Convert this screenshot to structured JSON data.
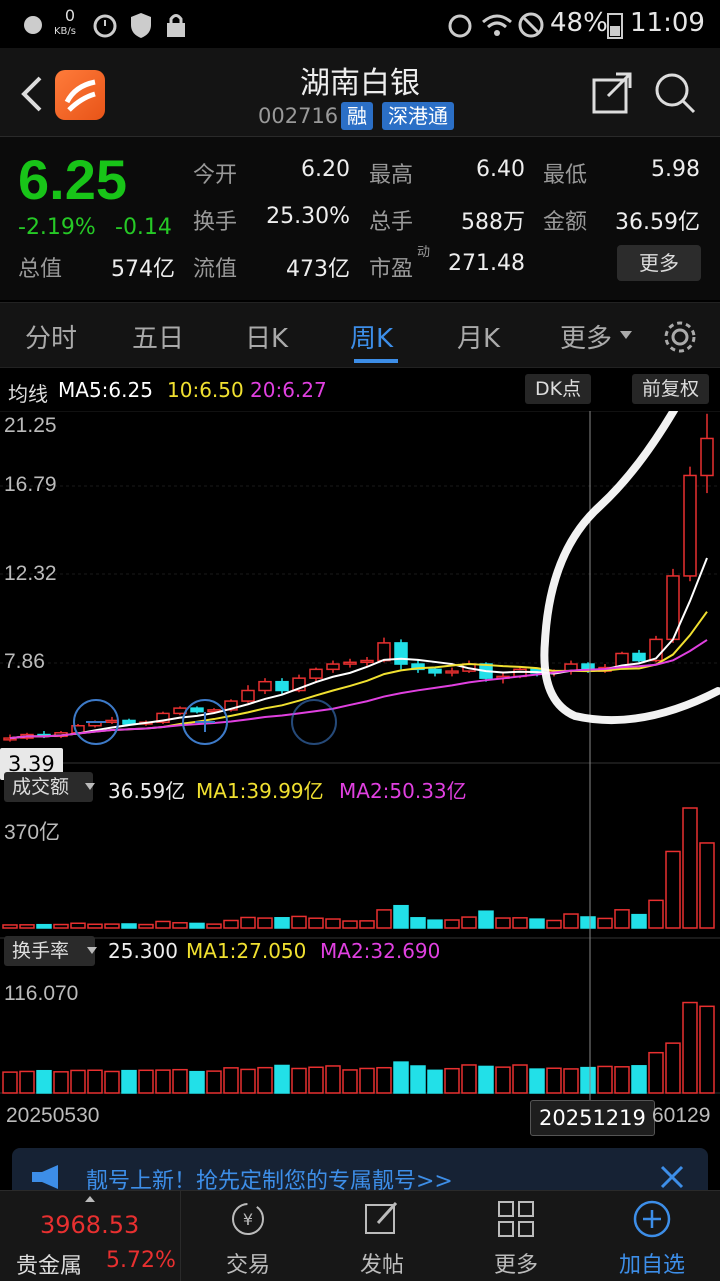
{
  "status": {
    "speed": "0",
    "speed_unit": "KB/s",
    "battery": "48%",
    "time": "11:09"
  },
  "header": {
    "name": "湖南白银",
    "code": "002716",
    "tags": [
      "融",
      "深港通"
    ]
  },
  "quote": {
    "price": "6.25",
    "change_pct": "-2.19%",
    "change": "-0.14",
    "fields": [
      {
        "label": "今开",
        "value": "6.20",
        "color": "green"
      },
      {
        "label": "最高",
        "value": "6.40",
        "color": "red"
      },
      {
        "label": "最低",
        "value": "5.98",
        "color": "green"
      },
      {
        "label": "换手",
        "value": "25.30%",
        "color": "white"
      },
      {
        "label": "总手",
        "value": "588万",
        "color": "white"
      },
      {
        "label": "金额",
        "value": "36.59亿",
        "color": "white"
      },
      {
        "label": "总值",
        "value": "574亿",
        "color": "white"
      },
      {
        "label": "流值",
        "value": "473亿",
        "color": "white"
      },
      {
        "label": "市盈",
        "sup": "动",
        "value": "271.48",
        "color": "white"
      }
    ],
    "more_label": "更多"
  },
  "tabs": [
    "分时",
    "五日",
    "日K",
    "周K",
    "月K",
    "更多"
  ],
  "active_tab": "周K",
  "kline": {
    "ma_title": "均线",
    "ma5": "MA5:6.25",
    "ma10": "10:6.50",
    "ma20": "20:6.27",
    "dk_label": "DK点",
    "fq_label": "前复权",
    "y_labels": [
      "21.25",
      "16.79",
      "12.32",
      "7.86"
    ],
    "low_marker": "3.39",
    "colors": {
      "up": "#e83030",
      "down": "#22e0e8",
      "ma5": "#ffffff",
      "ma10": "#f0e030",
      "ma20": "#e040e0"
    }
  },
  "volume": {
    "selector": "成交额",
    "value": "36.59亿",
    "ma1": "MA1:39.99亿",
    "ma2": "MA2:50.33亿",
    "max_label": "370亿"
  },
  "turnover": {
    "selector": "换手率",
    "value": "25.300",
    "ma1": "MA1:27.050",
    "ma2": "MA2:32.690",
    "max_label": "116.070"
  },
  "dates": {
    "start": "20250530",
    "cursor": "20251219",
    "end": "60129"
  },
  "ad": {
    "text": "靓号上新！抢先定制您的专属靓号>>"
  },
  "bottom": {
    "index_value": "3968.53",
    "index_name": "贵金属",
    "index_pct": "5.72%",
    "nav": [
      "交易",
      "发帖",
      "更多",
      "加自选"
    ]
  },
  "chart_data": {
    "type": "candlestick",
    "y_axis_labels": [
      21.25,
      16.79,
      12.32,
      7.86
    ],
    "x_labels": [
      "20250530",
      "20251219",
      "60129"
    ],
    "candles": [
      {
        "o": 3.5,
        "c": 3.6,
        "h": 3.8,
        "l": 3.4
      },
      {
        "o": 3.6,
        "c": 3.8,
        "h": 3.9,
        "l": 3.5
      },
      {
        "o": 3.8,
        "c": 3.7,
        "h": 4.0,
        "l": 3.6
      },
      {
        "o": 3.7,
        "c": 3.9,
        "h": 4.0,
        "l": 3.6
      },
      {
        "o": 3.9,
        "c": 4.3,
        "h": 4.4,
        "l": 3.8
      },
      {
        "o": 4.3,
        "c": 4.5,
        "h": 4.6,
        "l": 4.2
      },
      {
        "o": 4.5,
        "c": 4.6,
        "h": 4.8,
        "l": 4.4
      },
      {
        "o": 4.6,
        "c": 4.4,
        "h": 4.7,
        "l": 4.3
      },
      {
        "o": 4.4,
        "c": 4.5,
        "h": 4.6,
        "l": 4.3
      },
      {
        "o": 4.5,
        "c": 5.0,
        "h": 5.1,
        "l": 4.4
      },
      {
        "o": 5.0,
        "c": 5.3,
        "h": 5.4,
        "l": 4.9
      },
      {
        "o": 5.3,
        "c": 5.1,
        "h": 5.4,
        "l": 5.0
      },
      {
        "o": 5.1,
        "c": 5.2,
        "h": 5.3,
        "l": 5.0
      },
      {
        "o": 5.2,
        "c": 5.7,
        "h": 5.8,
        "l": 5.1
      },
      {
        "o": 5.7,
        "c": 6.3,
        "h": 6.6,
        "l": 5.6
      },
      {
        "o": 6.3,
        "c": 6.8,
        "h": 7.0,
        "l": 6.1
      },
      {
        "o": 6.8,
        "c": 6.3,
        "h": 7.0,
        "l": 6.1
      },
      {
        "o": 6.3,
        "c": 7.0,
        "h": 7.2,
        "l": 6.2
      },
      {
        "o": 7.0,
        "c": 7.5,
        "h": 7.6,
        "l": 6.8
      },
      {
        "o": 7.5,
        "c": 7.8,
        "h": 8.0,
        "l": 7.3
      },
      {
        "o": 7.8,
        "c": 7.9,
        "h": 8.1,
        "l": 7.6
      },
      {
        "o": 7.9,
        "c": 8.0,
        "h": 8.2,
        "l": 7.7
      },
      {
        "o": 8.0,
        "c": 9.0,
        "h": 9.3,
        "l": 7.9
      },
      {
        "o": 9.0,
        "c": 7.8,
        "h": 9.2,
        "l": 7.5
      },
      {
        "o": 7.8,
        "c": 7.5,
        "h": 8.0,
        "l": 7.3
      },
      {
        "o": 7.5,
        "c": 7.3,
        "h": 7.6,
        "l": 7.1
      },
      {
        "o": 7.3,
        "c": 7.4,
        "h": 7.6,
        "l": 7.1
      },
      {
        "o": 7.4,
        "c": 7.8,
        "h": 8.0,
        "l": 7.3
      },
      {
        "o": 7.8,
        "c": 7.0,
        "h": 7.9,
        "l": 6.8
      },
      {
        "o": 7.0,
        "c": 7.1,
        "h": 7.3,
        "l": 6.7
      },
      {
        "o": 7.1,
        "c": 7.5,
        "h": 7.6,
        "l": 7.0
      },
      {
        "o": 7.5,
        "c": 7.3,
        "h": 7.6,
        "l": 7.1
      },
      {
        "o": 7.3,
        "c": 7.4,
        "h": 7.5,
        "l": 7.1
      },
      {
        "o": 7.4,
        "c": 7.8,
        "h": 8.0,
        "l": 7.2
      },
      {
        "o": 7.8,
        "c": 7.4,
        "h": 7.9,
        "l": 7.3
      },
      {
        "o": 7.4,
        "c": 7.6,
        "h": 7.8,
        "l": 7.3
      },
      {
        "o": 7.6,
        "c": 8.4,
        "h": 8.5,
        "l": 7.5
      },
      {
        "o": 8.4,
        "c": 8.0,
        "h": 8.6,
        "l": 7.9
      },
      {
        "o": 8.0,
        "c": 9.2,
        "h": 9.4,
        "l": 7.9
      },
      {
        "o": 9.2,
        "c": 12.8,
        "h": 13.2,
        "l": 9.0
      },
      {
        "o": 12.8,
        "c": 18.5,
        "h": 19.0,
        "l": 12.5
      },
      {
        "o": 18.5,
        "c": 20.6,
        "h": 22.0,
        "l": 17.5
      }
    ]
  }
}
